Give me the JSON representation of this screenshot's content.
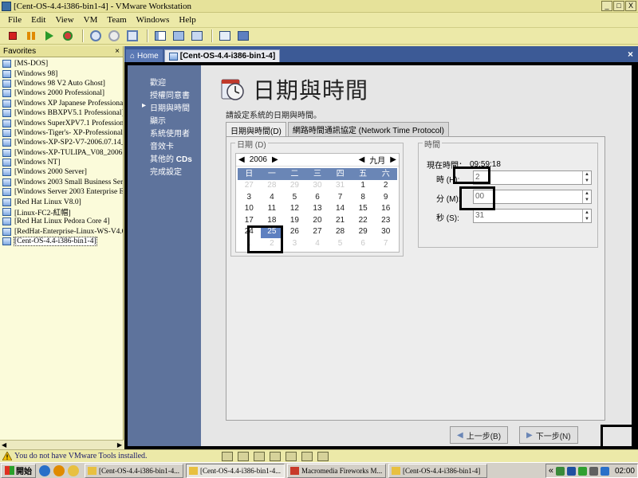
{
  "window": {
    "title": "[Cent-OS-4.4-i386-bin1-4] - VMware Workstation",
    "min": "_",
    "max": "□",
    "close": "X"
  },
  "menu": [
    "File",
    "Edit",
    "View",
    "VM",
    "Team",
    "Windows",
    "Help"
  ],
  "favorites": {
    "title": "Favorites",
    "close": "×",
    "items": [
      "[MS-DOS]",
      "[Windows 98]",
      "[Windows 98 V2 Auto Ghost]",
      "[Windows 2000 Professional]",
      "[Windows XP Japanese Professional",
      "[Windows BBXPV5.1 Professional]",
      "[Windows SuperXPV7.1 Professiona",
      "[Windows-Tiger's- XP-Professional-",
      "[Windows-XP-SP2-V7-2006.07.14_",
      "[Windows-XP-TULIPA_V08_2006.",
      "[Windows NT]",
      "[Windows 2000 Server]",
      "[Windows 2003 Small Business Serv",
      "[Windows Server 2003 Enterprise E",
      "[Red Hat Linux V8.0]",
      "[Linux-FC2-紅帽]",
      "[Red Hat Linux Pedora Core 4]",
      "[RedHat-Enterprise-Linux-WS-V4.0",
      "[Cent-OS-4.4-i386-bin1-4]"
    ],
    "selected_index": 18
  },
  "tabs": {
    "home": "Home",
    "active": "[Cent-OS-4.4-i386-bin1-4]",
    "close": "×"
  },
  "guest": {
    "steps": [
      "歡迎",
      "授權同意書",
      "日期與時間",
      "顯示",
      "系統使用者",
      "音效卡",
      "其他的",
      "完成設定"
    ],
    "steps_suffix_cds": "CDs",
    "title": "日期與時間",
    "subtitle": "請設定系統的日期與時間。",
    "tab_datetime": "日期與時間(D)",
    "tab_ntp": "網路時間通訊協定 (Network Time Protocol)",
    "date_group": "日期 (D)",
    "year": "2006",
    "month": "九月",
    "weekdays": [
      "日",
      "一",
      "二",
      "三",
      "四",
      "五",
      "六"
    ],
    "days": [
      {
        "d": "27",
        "dim": true
      },
      {
        "d": "28",
        "dim": true
      },
      {
        "d": "29",
        "dim": true
      },
      {
        "d": "30",
        "dim": true
      },
      {
        "d": "31",
        "dim": true
      },
      {
        "d": "1"
      },
      {
        "d": "2"
      },
      {
        "d": "3"
      },
      {
        "d": "4"
      },
      {
        "d": "5"
      },
      {
        "d": "6"
      },
      {
        "d": "7"
      },
      {
        "d": "8"
      },
      {
        "d": "9"
      },
      {
        "d": "10"
      },
      {
        "d": "11"
      },
      {
        "d": "12"
      },
      {
        "d": "13"
      },
      {
        "d": "14"
      },
      {
        "d": "15"
      },
      {
        "d": "16"
      },
      {
        "d": "17"
      },
      {
        "d": "18"
      },
      {
        "d": "19"
      },
      {
        "d": "20"
      },
      {
        "d": "21"
      },
      {
        "d": "22"
      },
      {
        "d": "23"
      },
      {
        "d": "24"
      },
      {
        "d": "25",
        "sel": true
      },
      {
        "d": "26"
      },
      {
        "d": "27"
      },
      {
        "d": "28"
      },
      {
        "d": "29"
      },
      {
        "d": "30"
      },
      {
        "d": "1",
        "dim": true
      },
      {
        "d": "2",
        "dim": true
      },
      {
        "d": "3",
        "dim": true
      },
      {
        "d": "4",
        "dim": true
      },
      {
        "d": "5",
        "dim": true
      },
      {
        "d": "6",
        "dim": true
      },
      {
        "d": "7",
        "dim": true
      }
    ],
    "time_group": "時間",
    "current_time_label": "現在時間：",
    "current_time": "09:59:18",
    "hour_label": "時 (H):",
    "hour_value": "2",
    "minute_label": "分 (M):",
    "minute_value": "00",
    "second_label": "秒 (S):",
    "second_value": "31",
    "back": "上一步(B)",
    "next": "下一步(N)"
  },
  "status": {
    "text": "You do not have VMware Tools installed."
  },
  "taskbar": {
    "start": "開始",
    "buttons": [
      {
        "label": "[Cent-OS-4.4-i386-bin1-4...",
        "pressed": false
      },
      {
        "label": "[Cent-OS-4.4-i386-bin1-4...",
        "pressed": true
      },
      {
        "label": "Macromedia Fireworks M...",
        "pressed": false
      },
      {
        "label": "[Cent-OS-4.4-i386-bin1-4]",
        "pressed": false
      }
    ],
    "tray_overflow": "«",
    "clock": "02:00"
  },
  "colors": {
    "accent": "#3C5A96",
    "guest_sidebar": "#5E739C",
    "calendar_header": "#6A86B6",
    "calendar_selected": "#5E80C0"
  }
}
